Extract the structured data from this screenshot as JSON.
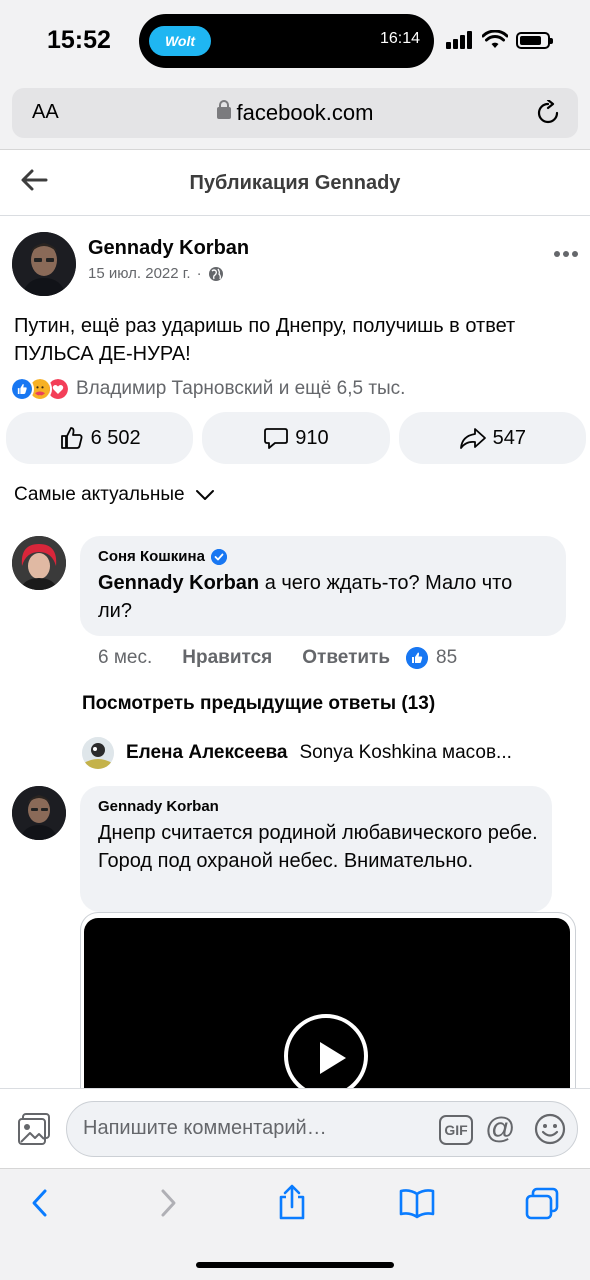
{
  "status_bar": {
    "time": "15:52",
    "island_app": "Wolt",
    "island_time": "16:14"
  },
  "browser": {
    "text_size_label": "AA",
    "url": "facebook.com"
  },
  "header": {
    "title": "Публикация Gennady"
  },
  "post": {
    "author": "Gennady Korban",
    "date": "15 июл. 2022 г.",
    "meta_separator": "·",
    "text": "Путин, ещё раз ударишь по Днепру, получишь в ответ ПУЛЬСА ДЕ-НУРА!",
    "reactions_summary": "Владимир Тарновский и ещё 6,5 тыс.",
    "likes": "6 502",
    "comments": "910",
    "shares": "547"
  },
  "sort": {
    "label": "Самые актуальные"
  },
  "comments": [
    {
      "author": "Соня Кошкина",
      "mention": "Gennady Korban",
      "text": "а чего ждать-то? Мало что ли?",
      "time": "6 мес.",
      "like_label": "Нравится",
      "reply_label": "Ответить",
      "like_count": "85"
    },
    {
      "author": "Gennady Korban",
      "text": "Днепр считается родиной любавического ребе. Город под охраной небес. Внимательно."
    }
  ],
  "replies": {
    "view_previous": "Посмотреть предыдущие ответы (13)",
    "preview_author": "Елена Алексеева",
    "preview_text": "Sonya Koshkina масов..."
  },
  "composer": {
    "placeholder": "Напишите комментарий…",
    "gif_label": "GIF",
    "at_label": "@"
  },
  "colors": {
    "facebook_blue": "#1877f2",
    "bubble_bg": "#f0f2f5",
    "secondary_text": "#65676b",
    "safari_blue": "#0a7cff"
  }
}
